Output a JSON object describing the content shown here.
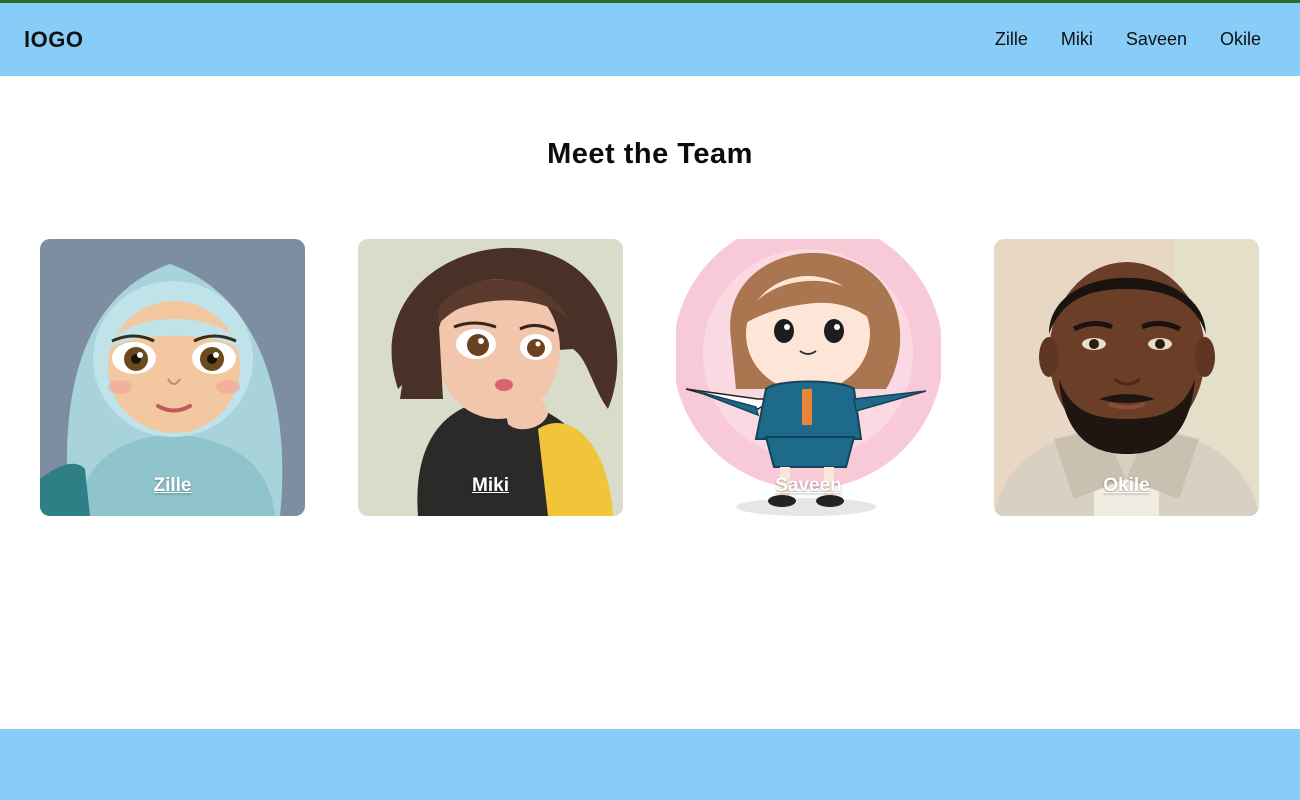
{
  "header": {
    "logo": "lOGO",
    "nav": [
      "Zille",
      "Miki",
      "Saveen",
      "Okile"
    ]
  },
  "main": {
    "title": "Meet the Team",
    "members": [
      {
        "name": "Zille",
        "icon": "hijab-girl-avatar"
      },
      {
        "name": "Miki",
        "icon": "brown-haired-girl-avatar"
      },
      {
        "name": "Saveen",
        "icon": "chibi-girl-avatar"
      },
      {
        "name": "Okile",
        "icon": "bearded-man-avatar"
      }
    ]
  },
  "colors": {
    "header_bg": "#87cdf7",
    "footer_bg": "#87cdf7",
    "top_line": "#2e6b2a"
  }
}
